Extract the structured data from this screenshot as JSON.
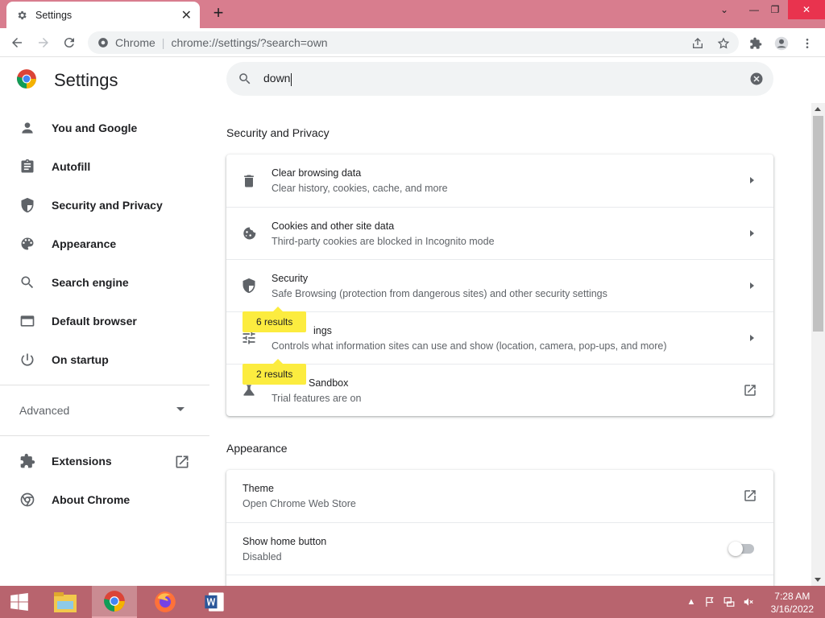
{
  "window": {
    "tab_title": "Settings",
    "tab_close": "✕",
    "new_tab": "+",
    "controls": {
      "dropdown": "⌄",
      "minimize": "—",
      "restore": "❐",
      "close": "✕"
    }
  },
  "address_bar": {
    "origin": "Chrome",
    "url": "chrome://settings/?search=own"
  },
  "settings": {
    "title": "Settings",
    "search_value": "down"
  },
  "sidebar": {
    "items": [
      {
        "label": "You and Google",
        "icon": "person-icon"
      },
      {
        "label": "Autofill",
        "icon": "clipboard-icon"
      },
      {
        "label": "Security and Privacy",
        "icon": "shield-icon"
      },
      {
        "label": "Appearance",
        "icon": "palette-icon"
      },
      {
        "label": "Search engine",
        "icon": "search-icon"
      },
      {
        "label": "Default browser",
        "icon": "browser-window-icon"
      },
      {
        "label": "On startup",
        "icon": "power-icon"
      }
    ],
    "advanced": "Advanced",
    "extensions": "Extensions",
    "about": "About Chrome"
  },
  "sections": {
    "security": {
      "title": "Security and Privacy",
      "rows": [
        {
          "title": "Clear browsing data",
          "subtitle": "Clear history, cookies, cache, and more"
        },
        {
          "title": "Cookies and other site data",
          "subtitle": "Third-party cookies are blocked in Incognito mode"
        },
        {
          "title": "Security",
          "subtitle": "Safe Browsing (protection from dangerous sites) and other security settings"
        },
        {
          "title": "Site Settings",
          "title_visible": "ings",
          "subtitle": "Controls what information sites can use and show (location, camera, pop-ups, and more)"
        },
        {
          "title": "Privacy Sandbox",
          "title_visible": "Sandbox",
          "subtitle": "Trial features are on"
        }
      ],
      "bubbles": [
        "6 results",
        "2 results"
      ]
    },
    "appearance": {
      "title": "Appearance",
      "rows": [
        {
          "title": "Theme",
          "subtitle": "Open Chrome Web Store"
        },
        {
          "title": "Show home button",
          "subtitle": "Disabled",
          "toggle_on": false
        }
      ]
    }
  },
  "taskbar": {
    "time": "7:28 AM",
    "date": "3/16/2022",
    "apps": [
      "file-explorer-icon",
      "chrome-icon",
      "firefox-icon",
      "word-icon"
    ]
  },
  "colors": {
    "tabstrip": "#d87d8e",
    "taskbar": "#b8646e",
    "highlight": "#fcec3f",
    "close_button": "#e9334e"
  }
}
